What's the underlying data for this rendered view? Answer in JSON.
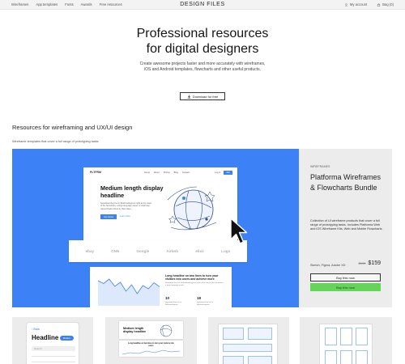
{
  "nav": {
    "links": [
      "Wireframes",
      "App templates",
      "Fonts",
      "Awards",
      "Free resources"
    ],
    "brand": "DESIGN FILES",
    "account_label": "My account",
    "bag_label": "Bag (0)"
  },
  "hero": {
    "title_line1": "Professional resources",
    "title_line2": "for digital designers",
    "subtitle": "Create awesome projects faster and more accurately with wireframes, iOS and Android templates, flowcharts and other useful products.",
    "download_label": "Download for free"
  },
  "section": {
    "title": "Resources for wireframing and UX/UI design",
    "subtitle": "Wireframe templates that cover a full range of prototyping tasks"
  },
  "feature": {
    "category": "WIREFRAMES",
    "title": "Platforma Wireframes & Flowcharts Bundle",
    "description": "Collection of UI wireframe products that cover a full range of prototyping tasks. Includes Platforma Web and iOS Wireframe Kits, Web and Mobile Flowcharts.",
    "formats": "Sketch, Figma, Adobe XD",
    "old_price": "$198",
    "price": "$159",
    "more_label": "Buy this now",
    "buy_label": "Buy this now",
    "mock": {
      "logo": "PLTFRM",
      "menu": [
        "Home",
        "About",
        "Pricing",
        "Blog",
        "Contact"
      ],
      "login": "Log in",
      "join": "Join",
      "headline": "Medium length display headline",
      "paragraph": "Separated they live in Bookmarksgrove right at the coast of the Semantics, a large language ocean. A small river named Duden flows by their place.",
      "cta": "Get started",
      "link": "Learn more",
      "logos": [
        "ebay",
        "CNN",
        "Google",
        "Airbnb",
        "elixir",
        "Logo"
      ],
      "stats_headline": "Long headline on two lines to turn your visitors into users and achieve more",
      "stats_para": "Separated they live in Bookmarksgrove right at the coast of the Semantics, a large language ocean.",
      "stat1_num": "10",
      "stat1_label": "Separated they live in Bookmarksgrove",
      "stat2_num": "18",
      "stat2_label": "Separated they live in Bookmarksgrove",
      "chart_points": [
        62,
        55,
        66,
        48,
        58,
        36,
        52,
        30,
        50,
        42,
        57,
        47
      ]
    },
    "colors": {
      "feature_bg": "#3c82f6",
      "buy_green": "#66d35a",
      "panel_bg": "#ececec"
    }
  },
  "thumbnails": {
    "mobile_back": "Back",
    "mobile_headline": "Headline",
    "mobile_button": "Button",
    "mobile_search": "Search",
    "web_headline": "Medium length display headline",
    "web_stats_headline": "Long headline on two lines to turn your visitors into users"
  }
}
